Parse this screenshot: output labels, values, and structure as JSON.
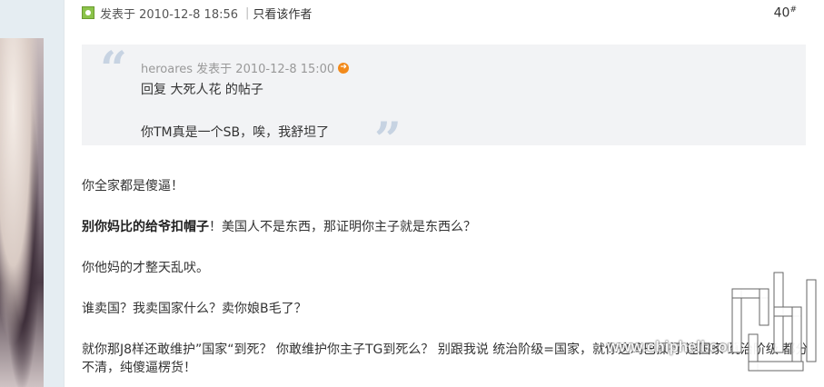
{
  "post": {
    "status_icon": "online-icon",
    "posted_label": "发表于 2010-12-8 18:56",
    "separator": "|",
    "only_author_link": "只看该作者",
    "floor": "40",
    "floor_sup": "#"
  },
  "quote": {
    "open_mark": "“",
    "close_mark": "”",
    "meta": "heroares 发表于 2010-12-8 15:00",
    "jump_icon": "arrow-circle-icon",
    "line1": "回复 大死人花 的帖子",
    "line2": "你TM真是一个SB，唉，我舒坦了"
  },
  "content": {
    "p1": "你全家都是傻逼！",
    "p2_bold": "别你妈比的给爷扣帽子",
    "p2_rest": "！美国人不是东西，那证明你主子就是东西么？",
    "p3": "你他妈的才整天乱吠。",
    "p4": "谁卖国？我卖国家什么？卖你娘B毛了？",
    "p5": "就你那J8样还敢维护”国家“到死？ 你敢维护你主子TG到死么？ 别跟我说 统治阶级=国家，就你这鸡巴操行 连国家 统治阶级 都分不清，纯傻逼楞货！"
  },
  "watermark": {
    "text": "www.chiphell.com",
    "logo": "chiphell-logo"
  },
  "colors": {
    "quote_bg": "#f2f3f5",
    "quote_marks": "#c7d3e2",
    "online_green": "#8bc34a",
    "arrow_orange": "#f28a1b",
    "sidebar_bg": "#e5edf2"
  }
}
